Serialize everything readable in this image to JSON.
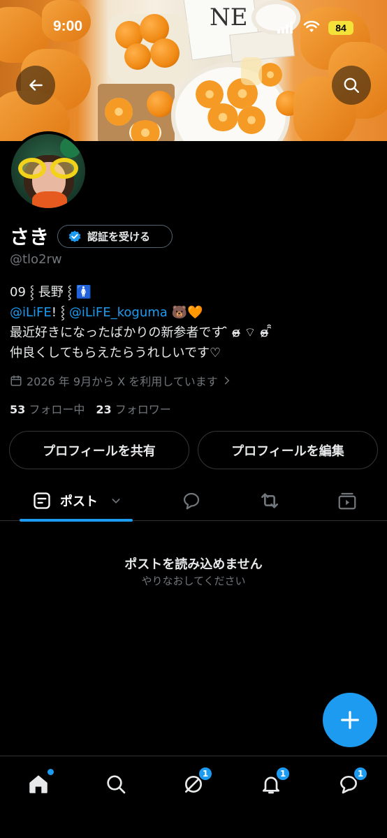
{
  "status_bar": {
    "time": "9:00",
    "battery": "84"
  },
  "header": {
    "back_icon": "arrow-left-icon",
    "search_icon": "search-icon"
  },
  "banner_text": "NE",
  "profile": {
    "name": "さき",
    "verify_label": "認証を受ける",
    "handle": "@tlo2rw",
    "bio": {
      "line1": "09 ⸾ 長野 ⸾ 🚺",
      "line2_link1": "@iLiFE",
      "line2_sep": "! ⸾ ",
      "line2_link2": "@iLiFE_koguma",
      "line2_emoji": " 🐻🧡",
      "line3": "最近好きになったばかりの新参者です ̑̑ ɞ̴̶̷ ⌔ ɞ̴̶̷ ̑̑",
      "line4": "仲良くしてもらえたらうれしいです♡"
    },
    "joined": "2026 年 9月から X を利用しています",
    "following_count": "53",
    "following_label": "フォロー中",
    "followers_count": "23",
    "followers_label": "フォロワー"
  },
  "actions": {
    "share_label": "プロフィールを共有",
    "edit_label": "プロフィールを編集"
  },
  "tabs": {
    "posts_label": "ポスト"
  },
  "empty_state": {
    "title": "ポストを読み込めません",
    "subtitle": "やりなおしてください"
  },
  "bottom_nav": {
    "grok_badge": "1",
    "notifications_badge": "1",
    "messages_badge": "1"
  },
  "colors": {
    "accent": "#1d9bf0",
    "background": "#000000",
    "muted": "#71767b"
  }
}
